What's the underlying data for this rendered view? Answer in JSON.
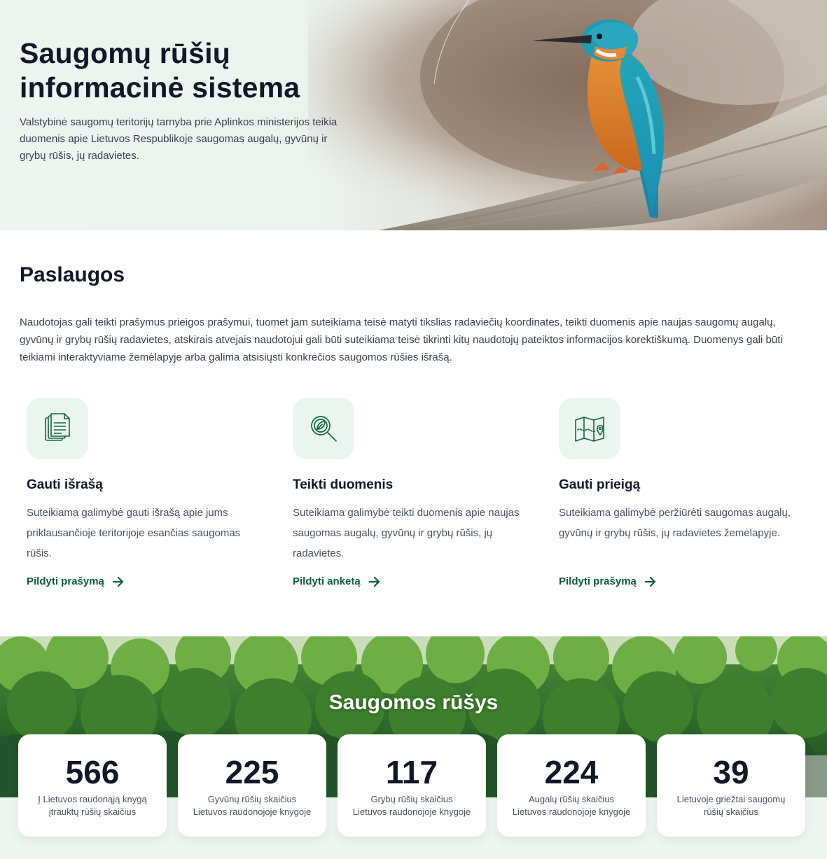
{
  "hero": {
    "title": "Saugomų rūšių informacinė sistema",
    "description": "Valstybinė saugomų teritorijų tarnyba prie Aplinkos ministerijos teikia duomenis apie Lietuvos Respublikoje saugomas augalų, gyvūnų ir grybų rūšis, jų radavietes.",
    "image": "kingfisher-on-branch"
  },
  "services": {
    "title": "Paslaugos",
    "description": "Naudotojas gali teikti prašymus prieigos prašymui, tuomet jam suteikiama teisė matyti tikslias radaviečių koordinates, teikti duomenis apie naujas saugomų augalų, gyvūnų ir grybų rūšių radavietes, atskirais atvejais naudotojui gali būti suteikiama teisė tikrinti kitų naudotojų pateiktos informacijos korektiškumą. Duomenys gali būti teikiami interaktyviame žemėlapyje arba galima atsisiųsti konkrečios saugomos rūšies išrašą.",
    "cards": [
      {
        "icon": "documents-icon",
        "title": "Gauti išrašą",
        "description": "Suteikiama galimybė gauti išrašą apie jums priklausančioje teritorijoje esančias saugomas rūšis.",
        "link": "Pildyti prašymą"
      },
      {
        "icon": "leaf-search-icon",
        "title": "Teikti duomenis",
        "description": "Suteikiama galimybė teikti duomenis apie naujas saugomas augalų, gyvūnų ir grybų rūšis, jų radavietes.",
        "link": "Pildyti anketą"
      },
      {
        "icon": "map-pin-icon",
        "title": "Gauti prieigą",
        "description": "Suteikiama galimybė peržiūrėti saugomas augalų, gyvūnų ir grybų rūšis, jų radavietes žemėlapyje.",
        "link": "Pildyti prašymą"
      }
    ]
  },
  "stats": {
    "title": "Saugomos rūšys",
    "items": [
      {
        "value": "566",
        "label_line1": "Į Lietuvos raudonąją knygą",
        "label_line2": "įtrauktų rūšių skaičius"
      },
      {
        "value": "225",
        "label_line1": "Gyvūnų rūšių skaičius",
        "label_line2": "Lietuvos raudonojoje knygoje"
      },
      {
        "value": "117",
        "label_line1": "Grybų rūšių skaičius",
        "label_line2": "Lietuvos raudonojoje knygoje"
      },
      {
        "value": "224",
        "label_line1": "Augalų rūšių skaičius",
        "label_line2": "Lietuvos raudonojoje knygoje"
      },
      {
        "value": "39",
        "label_line1": "Lietuvoje griežtai saugomų",
        "label_line2": "rūšių skaičius"
      }
    ]
  },
  "colors": {
    "accent": "#0e5c3a",
    "icon_bg": "#eaf5ef",
    "text": "#121826"
  }
}
